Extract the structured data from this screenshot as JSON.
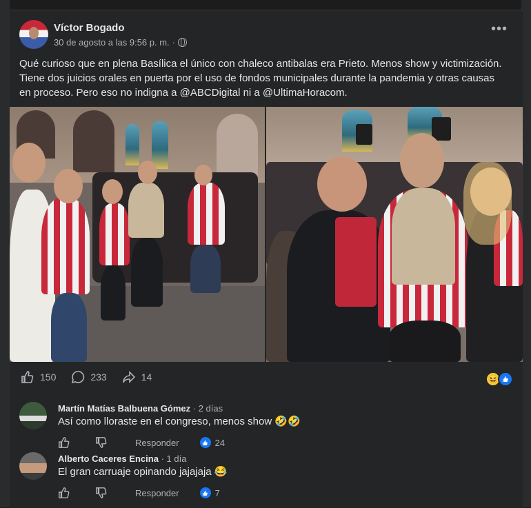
{
  "post": {
    "author": "Víctor Bogado",
    "timestamp": "30 de agosto a las 9:56 p. m.",
    "separator": "·",
    "privacy_icon": "globe-icon",
    "more_label": "•••",
    "text": "Qué curioso que en plena Basílica el único con chaleco antibalas era Prieto. Menos show y victimización. Tiene dos juicios orales en puerta por el uso de fondos municipales durante la pandemia y otras causas en proceso. Pero eso no indigna a @ABCDigital ni a @UltimaHoracom."
  },
  "stats": {
    "likes": "150",
    "comments": "233",
    "shares": "14",
    "reaction_icons": [
      "haha-reaction-icon",
      "like-reaction-icon"
    ]
  },
  "comments": [
    {
      "name": "Martín Matías Balbuena Gómez",
      "time": " · 2 días",
      "text": "Así como lloraste en el congreso, menos show 🤣🤣",
      "reply_label": "Responder",
      "likes": "24"
    },
    {
      "name": "Alberto Caceres Encina",
      "time": " · 1 día",
      "text": "El gran carruaje opinando jajajaja 😂",
      "reply_label": "Responder",
      "likes": "7"
    }
  ],
  "colors": {
    "background": "#242526",
    "text": "#e4e6eb",
    "muted": "#b0b3b8",
    "accent": "#1877f2",
    "jersey_red": "#c8283a"
  }
}
